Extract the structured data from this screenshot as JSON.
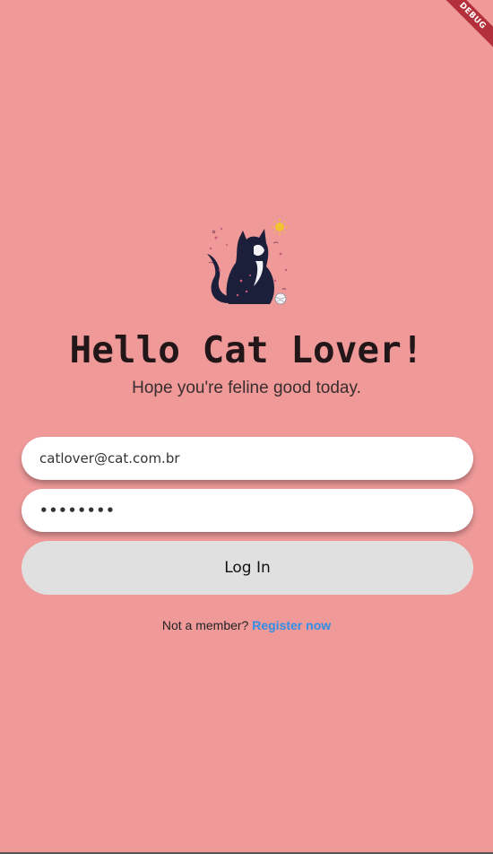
{
  "debug_banner": "DEBUG",
  "header": {
    "title": "Hello Cat Lover!",
    "subtitle": "Hope you're feline good today."
  },
  "form": {
    "email_value": "catlover@cat.com.br",
    "password_value": "••••••••",
    "login_label": "Log In"
  },
  "footer": {
    "prompt": "Not a member?",
    "register_label": "Register now"
  },
  "colors": {
    "background": "#ef9999",
    "field": "#ffffff",
    "button": "#e0e0e0",
    "link": "#2f8fe8",
    "cat": "#1c1f3a"
  },
  "icons": {
    "logo": "cat-illustration-icon"
  }
}
